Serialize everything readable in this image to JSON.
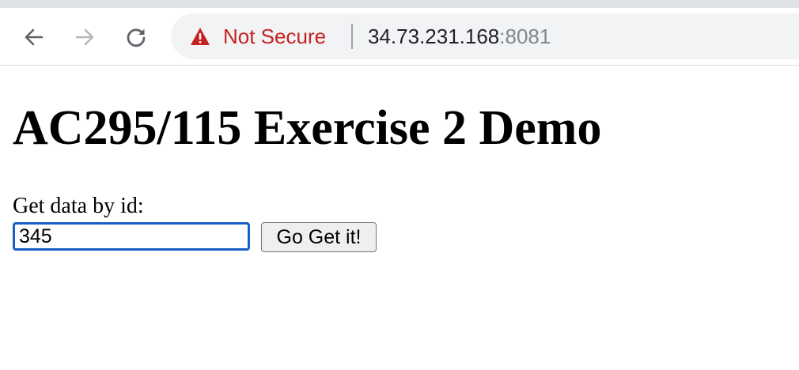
{
  "browser": {
    "security_label": "Not Secure",
    "url_host": "34.73.231.168",
    "url_port": ":8081",
    "icons": {
      "back": "arrow-left-icon",
      "forward": "arrow-right-icon",
      "reload": "reload-icon",
      "security": "warning-triangle-icon"
    },
    "colors": {
      "security_warning": "#c5221f",
      "omnibox_bg": "#f1f3f4",
      "tab_strip": "#dee1e6"
    }
  },
  "page": {
    "title": "AC295/115 Exercise 2 Demo",
    "form": {
      "label": "Get data by id:",
      "input_value": "345",
      "button_label": "Go Get it!"
    },
    "colors": {
      "input_focus_border": "#1a5fc8"
    }
  }
}
